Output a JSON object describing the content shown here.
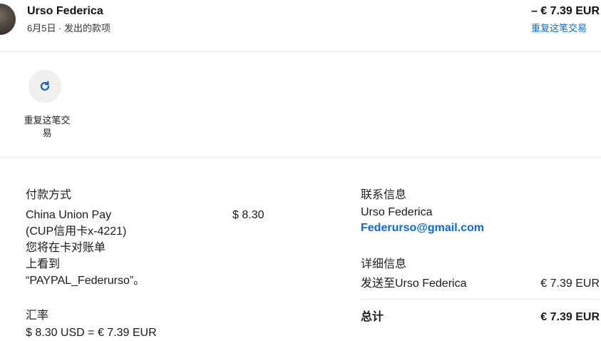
{
  "header": {
    "merchant_name": "Urso Federica",
    "subline": "6月5日 · 发出的款项",
    "amount": "– € 7.39 EUR",
    "repeat_link": "重复这笔交易"
  },
  "actions": {
    "repeat_label": "重复这笔交易",
    "repeat_icon": "refresh-icon"
  },
  "payment": {
    "title": "付款方式",
    "method_lines": [
      "China Union Pay",
      "(CUP信用卡x-4221)",
      "您将在卡对账单",
      "上看到",
      "“PAYPAL_Federurso”。"
    ],
    "method_amount": "$ 8.30"
  },
  "exchange": {
    "title": "汇率",
    "value": "$ 8.30 USD = € 7.39 EUR"
  },
  "contact": {
    "title": "联系信息",
    "name": "Urso Federica",
    "email": "Federurso@gmail.com"
  },
  "details": {
    "title": "详细信息",
    "sent_to_label": "发送至Urso Federica",
    "sent_to_amount": "€ 7.39 EUR",
    "total_label": "总计",
    "total_amount": "€ 7.39 EUR"
  },
  "colors": {
    "link": "#0a6ad6",
    "divider": "#e6e6e6",
    "action_circle": "#f1efed"
  }
}
